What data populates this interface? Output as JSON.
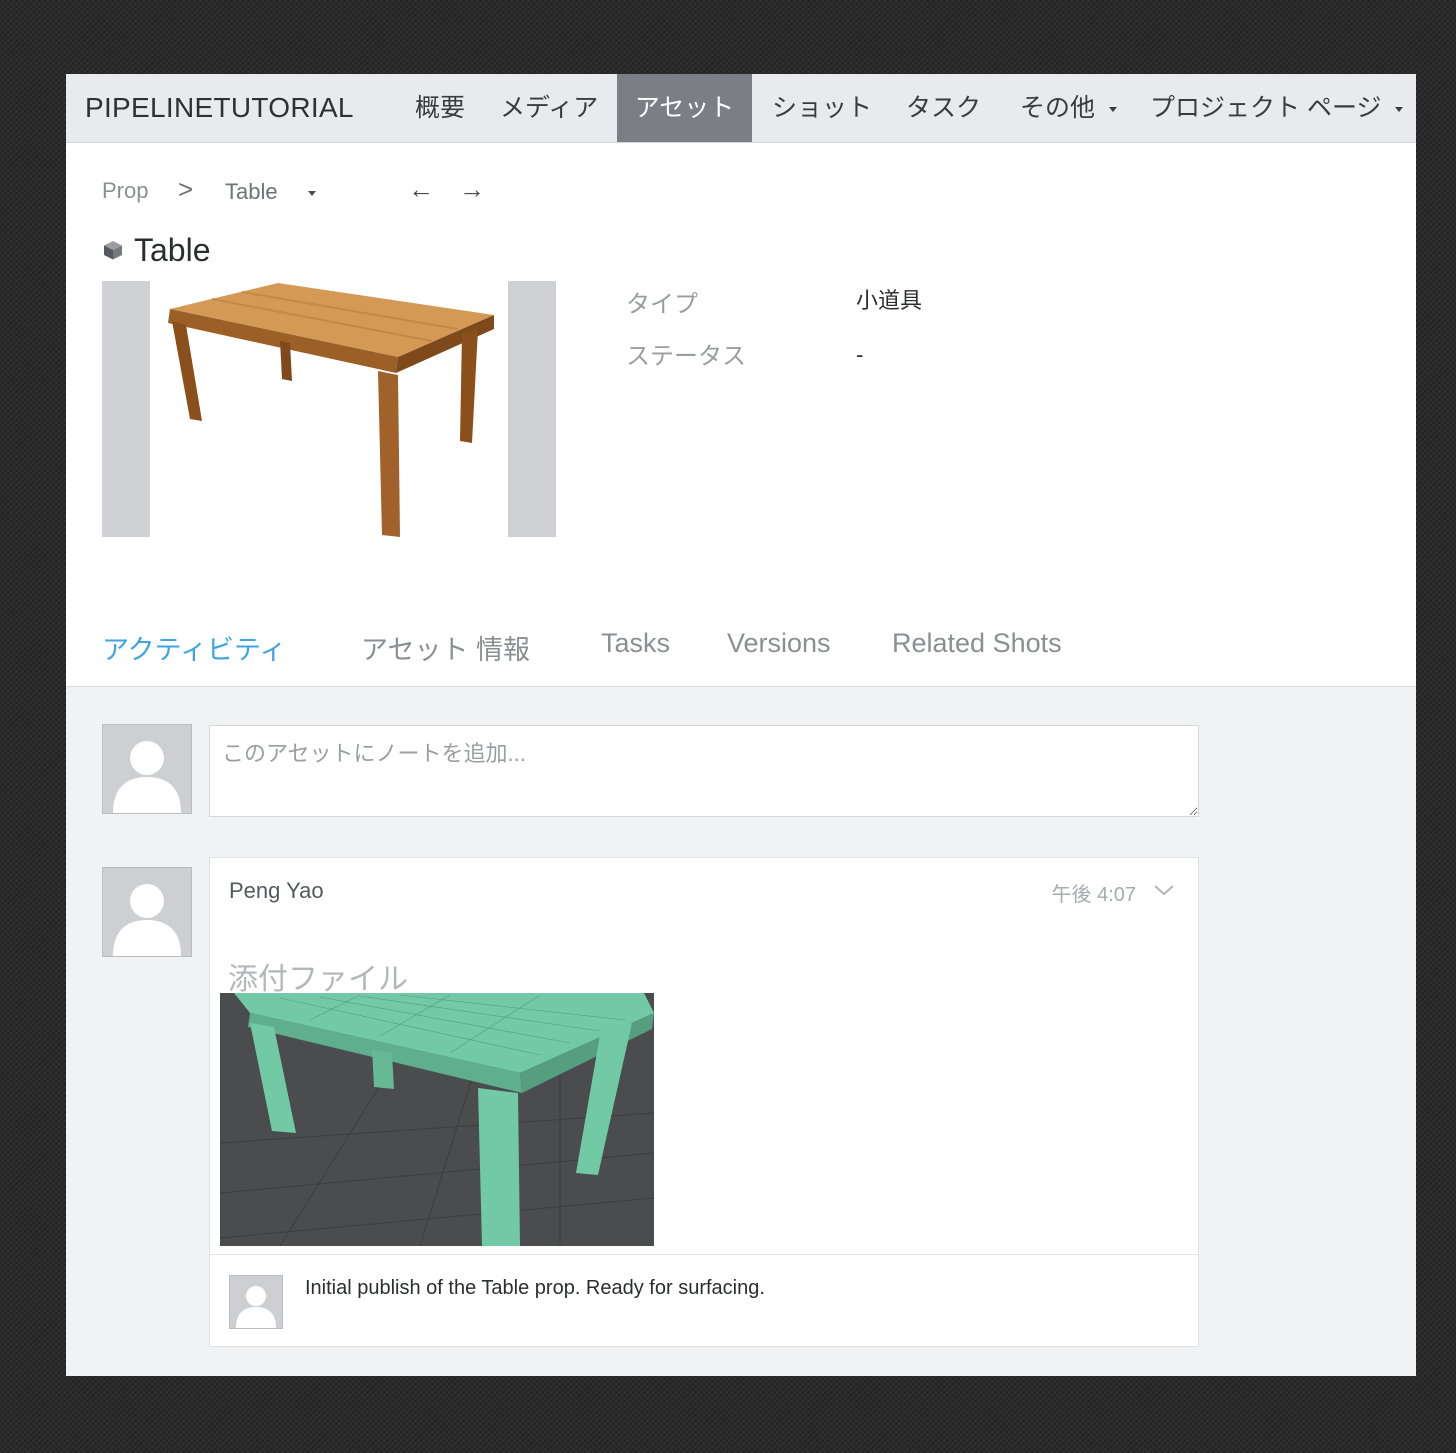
{
  "nav": {
    "brand": "PIPELINETUTORIAL",
    "items": [
      "概要",
      "メディア",
      "アセット",
      "ショット",
      "タスク",
      "その他",
      "プロジェクト ページ"
    ],
    "active": "アセット"
  },
  "breadcrumb": {
    "parent": "Prop",
    "separator": ">",
    "current": "Table",
    "prev_arrow": "←",
    "next_arrow": "→"
  },
  "page_title": "Table",
  "fields": {
    "type_label": "タイプ",
    "type_value": "小道具",
    "status_label": "ステータス",
    "status_value": "-"
  },
  "tabs": [
    "アクティビティ",
    "アセット 情報",
    "Tasks",
    "Versions",
    "Related Shots"
  ],
  "active_tab": "アクティビティ",
  "activity": {
    "note_placeholder": "このアセットにノートを追加...",
    "post": {
      "author": "Peng Yao",
      "time": "午後 4:07",
      "attachment_label": "添付ファイル",
      "reply_text": "Initial publish of the Table prop. Ready for surfacing."
    }
  },
  "icons": {
    "asset": "cube-icon",
    "avatar": "user-silhouette-icon",
    "expand": "chevron-down-icon",
    "dropdown": "caret-down-icon"
  },
  "colors": {
    "active_nav_bg": "#7b7f85",
    "active_tab": "#3fa5e0",
    "activity_bg": "#f1f2f4"
  }
}
